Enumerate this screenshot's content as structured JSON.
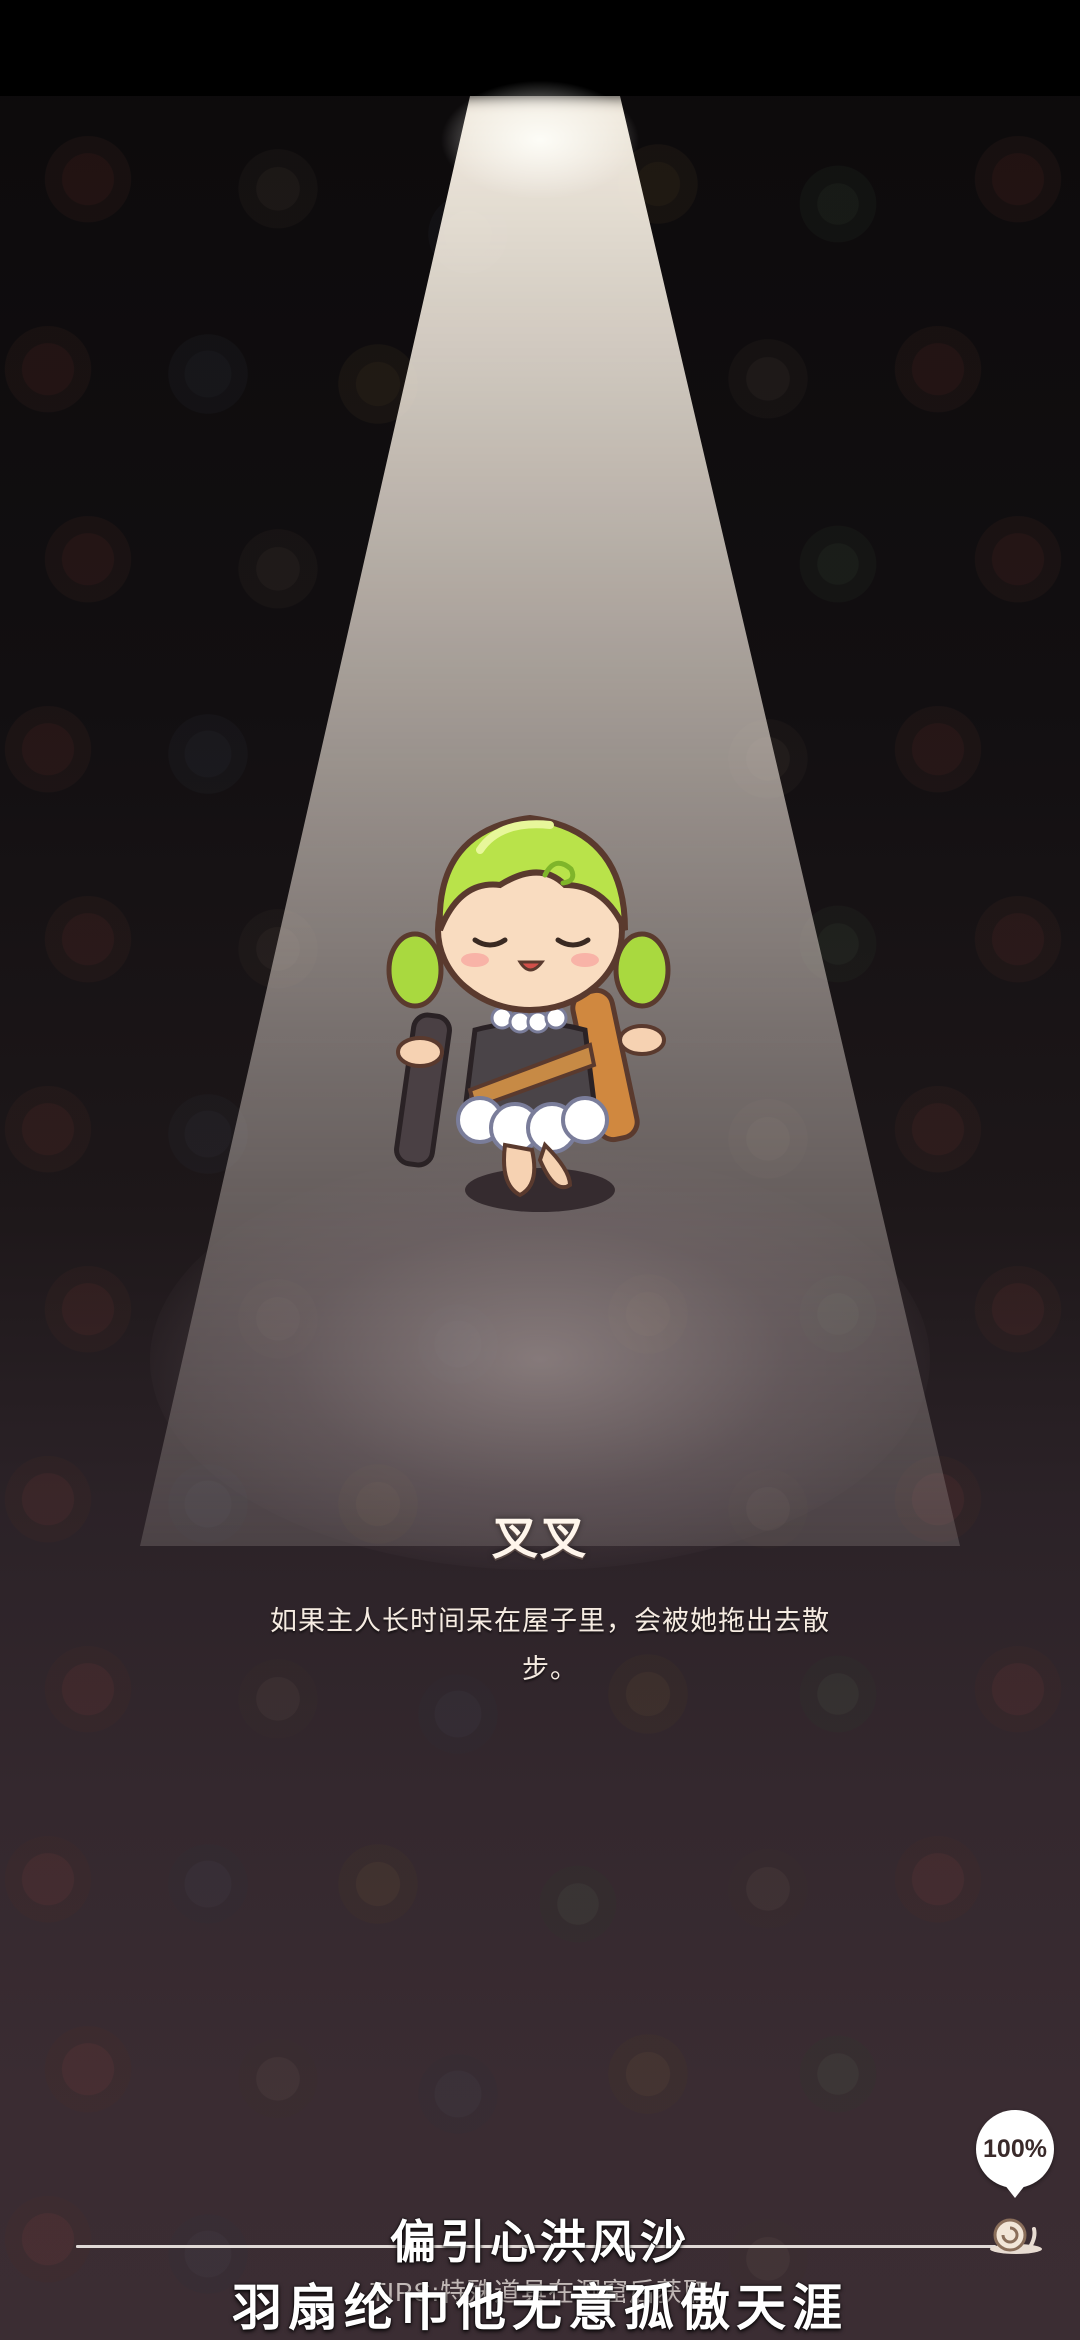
{
  "character": {
    "name": "叉叉",
    "description": "如果主人长时间呆在屋子里，会被她拖出去散步。"
  },
  "loading": {
    "progress": 1.0,
    "percent_label": "100%",
    "tip_text": "TIPS:特殊道具在洞窟后获取"
  },
  "lyrics": {
    "line1": "偏引心洪风沙",
    "line2": "羽扇纶巾他无意孤傲天涯"
  },
  "colors": {
    "background": "#1d1719",
    "spotlight": "#f5ede2",
    "character_hair": "#b9e34a",
    "text": "#fff6ec"
  }
}
